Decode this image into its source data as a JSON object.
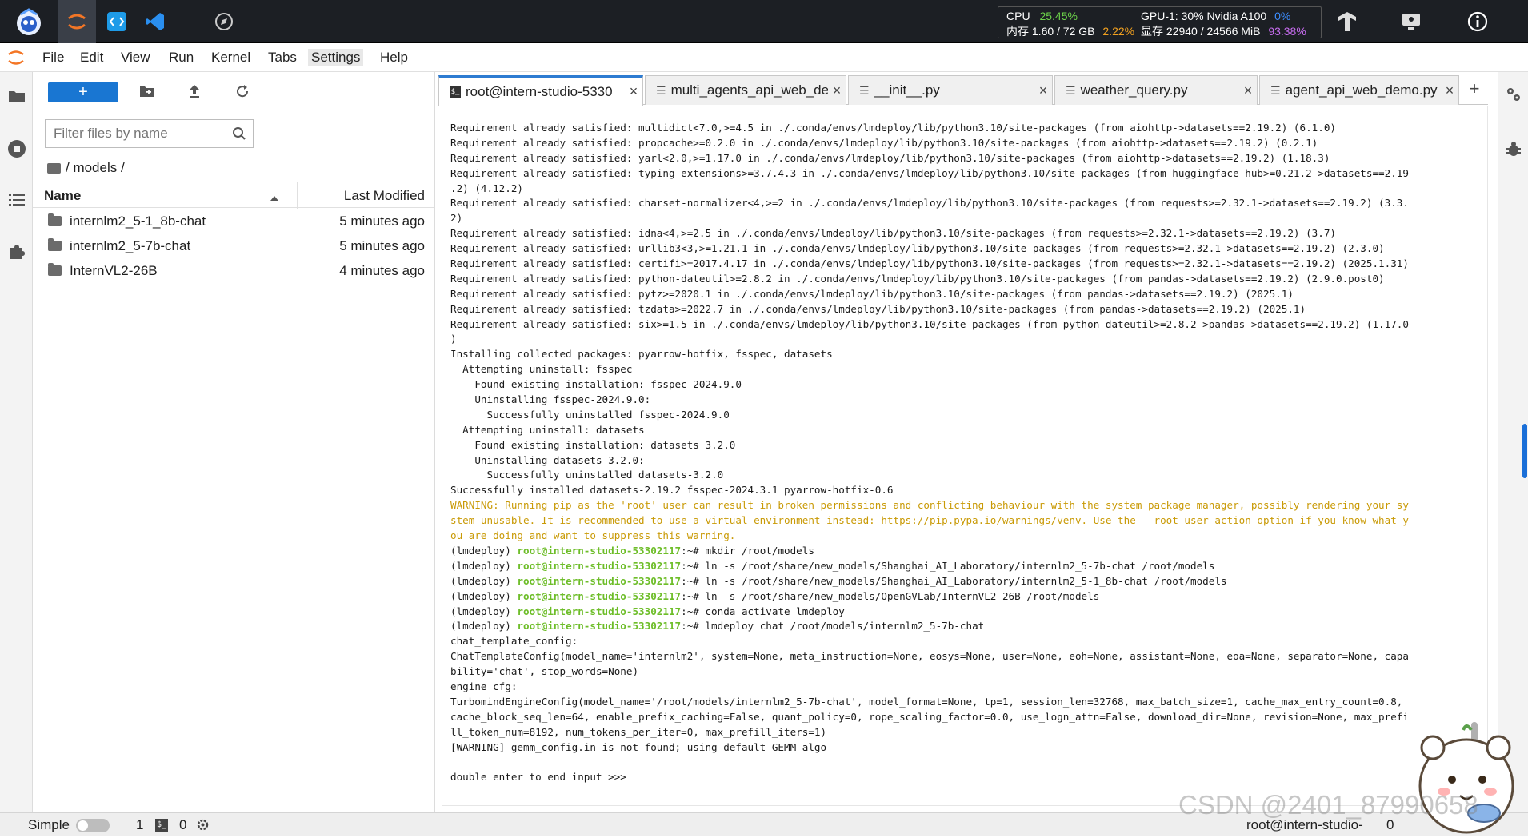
{
  "topbar": {
    "cpu_label": "CPU",
    "cpu_pct": "25.45%",
    "mem_label": "内存 1.60 / 72 GB",
    "mem_pct": "2.22%",
    "gpu_label": "GPU-1: 30% Nvidia A100",
    "gpu_pct": "0%",
    "vram_label": "显存 22940 / 24566 MiB",
    "vram_pct": "93.38%",
    "colors": {
      "green": "#6dd44a",
      "orange": "#f0a020",
      "blue": "#3c8dff"
    }
  },
  "menu": [
    "File",
    "Edit",
    "View",
    "Run",
    "Kernel",
    "Tabs",
    "Settings",
    "Help"
  ],
  "filebrowser": {
    "new_label": "+",
    "filter_placeholder": "Filter files by name",
    "breadcrumb": "/ models /",
    "col_name": "Name",
    "col_modified": "Last Modified",
    "files": [
      {
        "name": "internlm2_5-1_8b-chat",
        "modified": "5 minutes ago"
      },
      {
        "name": "internlm2_5-7b-chat",
        "modified": "5 minutes ago"
      },
      {
        "name": "InternVL2-26B",
        "modified": "4 minutes ago"
      }
    ]
  },
  "tabs": [
    {
      "label": "root@intern-studio-5330"
    },
    {
      "label": "multi_agents_api_web_de"
    },
    {
      "label": "__init__.py"
    },
    {
      "label": "weather_query.py"
    },
    {
      "label": "agent_api_web_demo.py"
    }
  ],
  "terminal": {
    "lines": [
      [
        {
          "t": "Requirement already satisfied: multidict<7.0,>=4.5 in ./.conda/envs/lmdeploy/lib/python3.10/site-packages (from aiohttp->datasets==2.19.2) (6.1.0)"
        }
      ],
      [
        {
          "t": "Requirement already satisfied: propcache>=0.2.0 in ./.conda/envs/lmdeploy/lib/python3.10/site-packages (from aiohttp->datasets==2.19.2) (0.2.1)"
        }
      ],
      [
        {
          "t": "Requirement already satisfied: yarl<2.0,>=1.17.0 in ./.conda/envs/lmdeploy/lib/python3.10/site-packages (from aiohttp->datasets==2.19.2) (1.18.3)"
        }
      ],
      [
        {
          "t": "Requirement already satisfied: typing-extensions>=3.7.4.3 in ./.conda/envs/lmdeploy/lib/python3.10/site-packages (from huggingface-hub>=0.21.2->datasets==2.19"
        }
      ],
      [
        {
          "t": ".2) (4.12.2)"
        }
      ],
      [
        {
          "t": "Requirement already satisfied: charset-normalizer<4,>=2 in ./.conda/envs/lmdeploy/lib/python3.10/site-packages (from requests>=2.32.1->datasets==2.19.2) (3.3."
        }
      ],
      [
        {
          "t": "2)"
        }
      ],
      [
        {
          "t": "Requirement already satisfied: idna<4,>=2.5 in ./.conda/envs/lmdeploy/lib/python3.10/site-packages (from requests>=2.32.1->datasets==2.19.2) (3.7)"
        }
      ],
      [
        {
          "t": "Requirement already satisfied: urllib3<3,>=1.21.1 in ./.conda/envs/lmdeploy/lib/python3.10/site-packages (from requests>=2.32.1->datasets==2.19.2) (2.3.0)"
        }
      ],
      [
        {
          "t": "Requirement already satisfied: certifi>=2017.4.17 in ./.conda/envs/lmdeploy/lib/python3.10/site-packages (from requests>=2.32.1->datasets==2.19.2) (2025.1.31)"
        }
      ],
      [
        {
          "t": "Requirement already satisfied: python-dateutil>=2.8.2 in ./.conda/envs/lmdeploy/lib/python3.10/site-packages (from pandas->datasets==2.19.2) (2.9.0.post0)"
        }
      ],
      [
        {
          "t": "Requirement already satisfied: pytz>=2020.1 in ./.conda/envs/lmdeploy/lib/python3.10/site-packages (from pandas->datasets==2.19.2) (2025.1)"
        }
      ],
      [
        {
          "t": "Requirement already satisfied: tzdata>=2022.7 in ./.conda/envs/lmdeploy/lib/python3.10/site-packages (from pandas->datasets==2.19.2) (2025.1)"
        }
      ],
      [
        {
          "t": "Requirement already satisfied: six>=1.5 in ./.conda/envs/lmdeploy/lib/python3.10/site-packages (from python-dateutil>=2.8.2->pandas->datasets==2.19.2) (1.17.0"
        }
      ],
      [
        {
          "t": ")"
        }
      ],
      [
        {
          "t": "Installing collected packages: pyarrow-hotfix, fsspec, datasets"
        }
      ],
      [
        {
          "t": "  Attempting uninstall: fsspec"
        }
      ],
      [
        {
          "t": "    Found existing installation: fsspec 2024.9.0"
        }
      ],
      [
        {
          "t": "    Uninstalling fsspec-2024.9.0:"
        }
      ],
      [
        {
          "t": "      Successfully uninstalled fsspec-2024.9.0"
        }
      ],
      [
        {
          "t": "  Attempting uninstall: datasets"
        }
      ],
      [
        {
          "t": "    Found existing installation: datasets 3.2.0"
        }
      ],
      [
        {
          "t": "    Uninstalling datasets-3.2.0:"
        }
      ],
      [
        {
          "t": "      Successfully uninstalled datasets-3.2.0"
        }
      ],
      [
        {
          "t": "Successfully installed datasets-2.19.2 fsspec-2024.3.1 pyarrow-hotfix-0.6"
        }
      ],
      [
        {
          "t": "WARNING: Running pip as the 'root' user can result in broken permissions and conflicting behaviour with the system package manager, possibly rendering your sy",
          "c": "warn"
        }
      ],
      [
        {
          "t": "stem unusable. It is recommended to use a virtual environment instead: https://pip.pypa.io/warnings/venv. Use the --root-user-action option if you know what y",
          "c": "warn"
        }
      ],
      [
        {
          "t": "ou are doing and want to suppress this warning.",
          "c": "warn"
        }
      ],
      [
        {
          "t": "(lmdeploy) "
        },
        {
          "t": "root@intern-studio-53302117",
          "c": "pr"
        },
        {
          "t": ":~# mkdir /root/models"
        }
      ],
      [
        {
          "t": "(lmdeploy) "
        },
        {
          "t": "root@intern-studio-53302117",
          "c": "pr"
        },
        {
          "t": ":~# ln -s /root/share/new_models/Shanghai_AI_Laboratory/internlm2_5-7b-chat /root/models"
        }
      ],
      [
        {
          "t": "(lmdeploy) "
        },
        {
          "t": "root@intern-studio-53302117",
          "c": "pr"
        },
        {
          "t": ":~# ln -s /root/share/new_models/Shanghai_AI_Laboratory/internlm2_5-1_8b-chat /root/models"
        }
      ],
      [
        {
          "t": "(lmdeploy) "
        },
        {
          "t": "root@intern-studio-53302117",
          "c": "pr"
        },
        {
          "t": ":~# ln -s /root/share/new_models/OpenGVLab/InternVL2-26B /root/models"
        }
      ],
      [
        {
          "t": "(lmdeploy) "
        },
        {
          "t": "root@intern-studio-53302117",
          "c": "pr"
        },
        {
          "t": ":~# conda activate lmdeploy"
        }
      ],
      [
        {
          "t": "(lmdeploy) "
        },
        {
          "t": "root@intern-studio-53302117",
          "c": "pr"
        },
        {
          "t": ":~# lmdeploy chat /root/models/internlm2_5-7b-chat"
        }
      ],
      [
        {
          "t": "chat_template_config:"
        }
      ],
      [
        {
          "t": "ChatTemplateConfig(model_name='internlm2', system=None, meta_instruction=None, eosys=None, user=None, eoh=None, assistant=None, eoa=None, separator=None, capa"
        }
      ],
      [
        {
          "t": "bility='chat', stop_words=None)"
        }
      ],
      [
        {
          "t": "engine_cfg:"
        }
      ],
      [
        {
          "t": "TurbomindEngineConfig(model_name='/root/models/internlm2_5-7b-chat', model_format=None, tp=1, session_len=32768, max_batch_size=1, cache_max_entry_count=0.8,"
        }
      ],
      [
        {
          "t": "cache_block_seq_len=64, enable_prefix_caching=False, quant_policy=0, rope_scaling_factor=0.0, use_logn_attn=False, download_dir=None, revision=None, max_prefi"
        }
      ],
      [
        {
          "t": "ll_token_num=8192, num_tokens_per_iter=0, max_prefill_iters=1)"
        }
      ],
      [
        {
          "t": "[WARNING] gemm_config.in is not found; using default GEMM algo"
        }
      ],
      [
        {
          "t": ""
        }
      ],
      [
        {
          "t": "double enter to end input >>>"
        }
      ]
    ]
  },
  "status": {
    "mode_label": "Simple",
    "count1": "1",
    "count2": "0",
    "right_label": "root@intern-studio-",
    "right_suffix": "0",
    "watermark": "CSDN @2401_87990658"
  }
}
